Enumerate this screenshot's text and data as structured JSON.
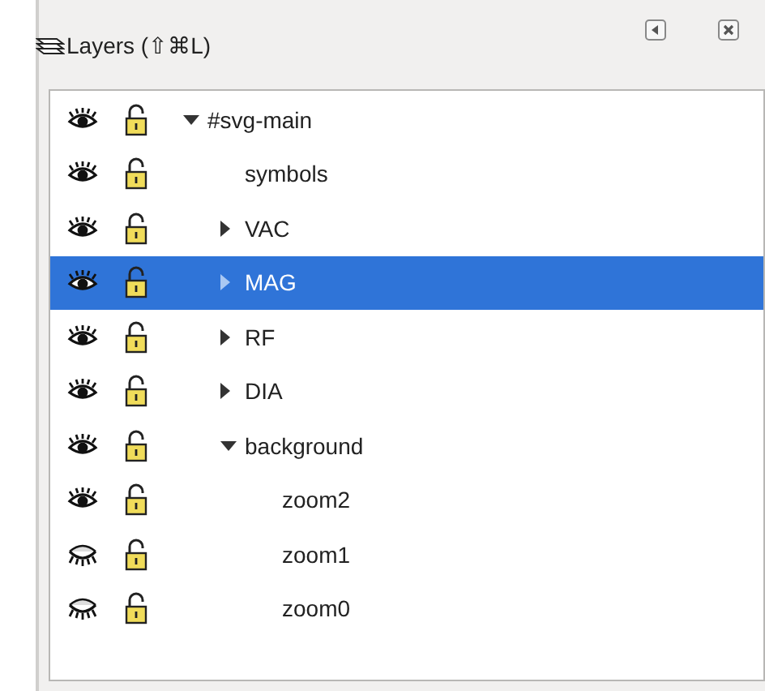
{
  "panel": {
    "title": "Layers (⇧⌘L)"
  },
  "layers": [
    {
      "name": "#svg-main",
      "visible": true,
      "locked": false,
      "selected": false,
      "expanded": true,
      "children": [
        {
          "name": "symbols",
          "visible": true,
          "locked": false,
          "selected": false
        },
        {
          "name": "VAC",
          "visible": true,
          "locked": false,
          "selected": false,
          "expanded": false
        },
        {
          "name": "MAG",
          "visible": true,
          "locked": false,
          "selected": true,
          "expanded": false
        },
        {
          "name": "RF",
          "visible": true,
          "locked": false,
          "selected": false,
          "expanded": false
        },
        {
          "name": "DIA",
          "visible": true,
          "locked": false,
          "selected": false,
          "expanded": false
        },
        {
          "name": "background",
          "visible": true,
          "locked": false,
          "selected": false,
          "expanded": true,
          "children": [
            {
              "name": "zoom2",
              "visible": true,
              "locked": false,
              "selected": false
            },
            {
              "name": "zoom1",
              "visible": false,
              "locked": false,
              "selected": false
            },
            {
              "name": "zoom0",
              "visible": false,
              "locked": false,
              "selected": false
            }
          ]
        }
      ]
    }
  ]
}
